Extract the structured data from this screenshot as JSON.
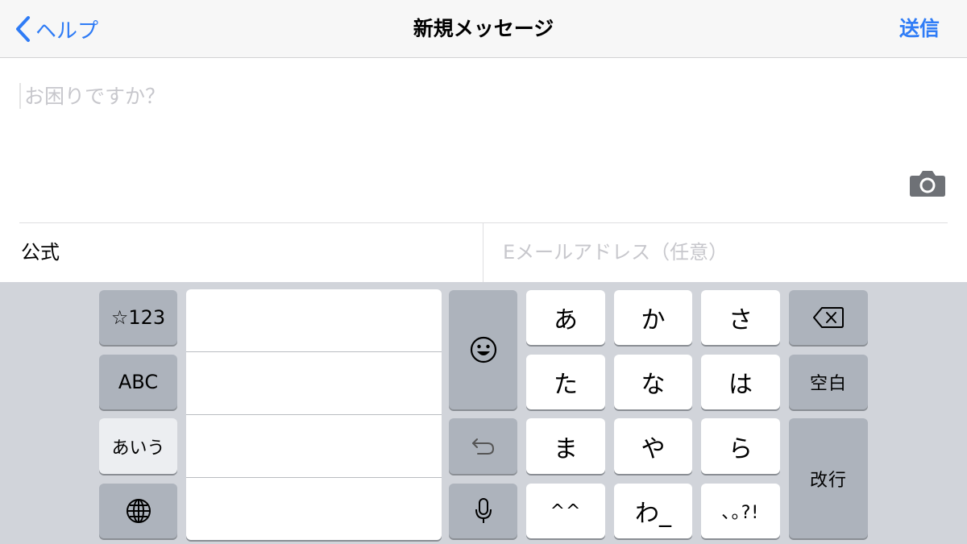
{
  "navbar": {
    "back_label": "ヘルプ",
    "title": "新規メッセージ",
    "send_label": "送信"
  },
  "compose": {
    "message_placeholder": "お困りですか？"
  },
  "fields": {
    "left_label": "公式",
    "email_placeholder": "Eメールアドレス（任意）"
  },
  "keyboard": {
    "symbols_key": "☆123",
    "abc_key": "ABC",
    "kana_mode_key": "あいう",
    "kana": [
      "あ",
      "か",
      "さ",
      "た",
      "な",
      "は",
      "ま",
      "や",
      "ら",
      "^^",
      "わ_",
      "､｡?!"
    ],
    "space_key": "空白",
    "return_key": "改行"
  },
  "colors": {
    "accent": "#2f7cf6",
    "keyboard_bg": "#d1d4da",
    "dark_key": "#adb3bc",
    "placeholder": "#c7c7cc"
  }
}
